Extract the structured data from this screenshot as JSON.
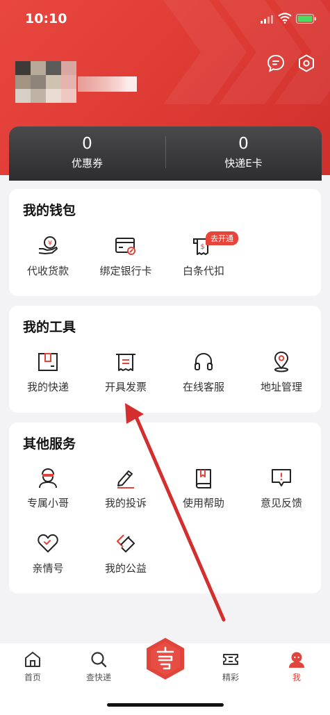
{
  "status": {
    "time": "10:10"
  },
  "stats": [
    {
      "value": "0",
      "label": "优惠券"
    },
    {
      "value": "0",
      "label": "快递E卡"
    }
  ],
  "wallet": {
    "title": "我的钱包",
    "items": [
      {
        "label": "代收货款",
        "icon": "cash-on-delivery-icon"
      },
      {
        "label": "绑定银行卡",
        "icon": "bank-card-link-icon"
      },
      {
        "label": "白条代扣",
        "icon": "ious-deduction-icon"
      }
    ],
    "badge": "去开通"
  },
  "tools": {
    "title": "我的工具",
    "items": [
      {
        "label": "我的快递",
        "icon": "package-box-icon"
      },
      {
        "label": "开具发票",
        "icon": "invoice-printer-icon"
      },
      {
        "label": "在线客服",
        "icon": "headset-icon"
      },
      {
        "label": "地址管理",
        "icon": "location-pin-icon"
      }
    ]
  },
  "services": {
    "title": "其他服务",
    "items": [
      {
        "label": "专属小哥",
        "icon": "courier-person-icon"
      },
      {
        "label": "我的投诉",
        "icon": "edit-pen-icon"
      },
      {
        "label": "使用帮助",
        "icon": "help-book-icon"
      },
      {
        "label": "意见反馈",
        "icon": "feedback-bubble-icon"
      },
      {
        "label": "亲情号",
        "icon": "heart-icon"
      },
      {
        "label": "我的公益",
        "icon": "charity-icon"
      }
    ]
  },
  "tabbar": {
    "items": [
      {
        "label": "首页",
        "icon": "home-icon"
      },
      {
        "label": "查快递",
        "icon": "search-icon"
      },
      {
        "label": "精彩",
        "icon": "ticket-icon"
      },
      {
        "label": "我",
        "icon": "profile-icon"
      }
    ],
    "center_icon": "send-package-logo-icon",
    "active": "我"
  },
  "colors": {
    "brand_red": "#e0443b",
    "stats_bg": "#3a3a3c",
    "page_bg": "#f3f3f5"
  }
}
